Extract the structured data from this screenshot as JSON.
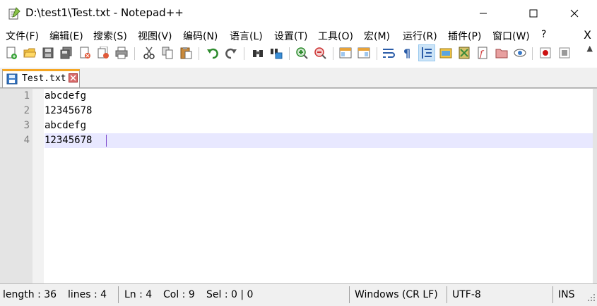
{
  "window": {
    "title": "D:\\test1\\Test.txt - Notepad++"
  },
  "menu": {
    "items": [
      "文件(F)",
      "编辑(E)",
      "搜索(S)",
      "视图(V)",
      "编码(N)",
      "语言(L)",
      "设置(T)",
      "工具(O)",
      "宏(M)",
      "运行(R)",
      "插件(P)",
      "窗口(W)",
      "?"
    ],
    "close_label": "X"
  },
  "toolbar": {
    "icons": [
      "new-file",
      "open-file",
      "save",
      "save-all",
      "close",
      "close-all",
      "print",
      "cut",
      "copy",
      "paste",
      "undo",
      "redo",
      "find",
      "replace",
      "zoom-in",
      "zoom-out",
      "sync-vertical",
      "sync-horizontal",
      "word-wrap",
      "show-all-chars",
      "indent-guide",
      "user-defined-lang",
      "doc-map",
      "function-list",
      "folder-as-workspace",
      "monitoring",
      "record-macro",
      "stop-record"
    ],
    "chevron": "▲"
  },
  "tabs": [
    {
      "label": "Test.txt",
      "active": true
    }
  ],
  "editor": {
    "lines": [
      "abcdefg",
      "12345678",
      "abcdefg",
      "12345678"
    ],
    "line_numbers": [
      "1",
      "2",
      "3",
      "4"
    ],
    "current_line": 4,
    "caret_column": 9
  },
  "status": {
    "length": "length : 36",
    "lines": "lines : 4",
    "ln": "Ln : 4",
    "col": "Col : 9",
    "sel": "Sel : 0 | 0",
    "eol": "Windows (CR LF)",
    "encoding": "UTF-8",
    "mode": "INS"
  },
  "colors": {
    "current_line": "#e8e8ff",
    "tab_accent": "#f5a623",
    "gutter": "#e4e4e4",
    "caret": "#7a44cc"
  }
}
